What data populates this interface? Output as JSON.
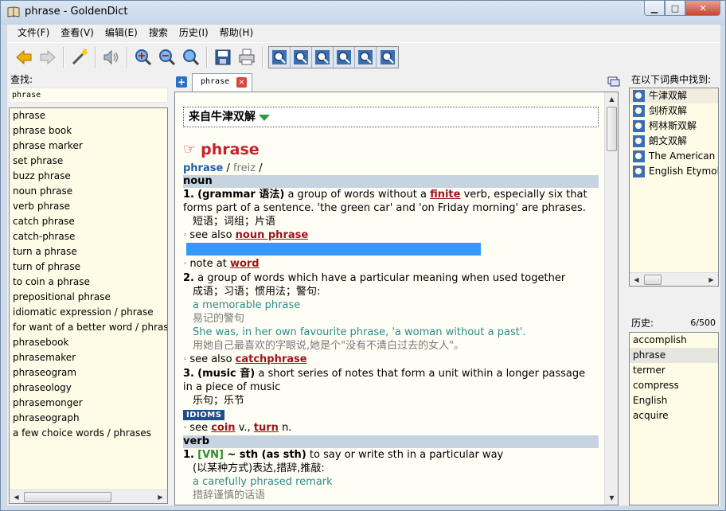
{
  "window": {
    "title": "phrase - GoldenDict"
  },
  "menu": [
    "文件(F)",
    "查看(V)",
    "编辑(E)",
    "搜索",
    "历史(I)",
    "帮助(H)"
  ],
  "toolbar": {
    "buttons": [
      "back-icon",
      "forward-icon",
      "scan-popup-icon",
      "pronounce-icon",
      "zoom-in-icon",
      "zoom-out-icon",
      "zoom-reset-icon",
      "save-icon",
      "print-icon"
    ],
    "dict_buttons": 6
  },
  "left": {
    "label": "查找:",
    "search_value": "phrase",
    "words": [
      "phrase",
      "phrase book",
      "phrase marker",
      "set phrase",
      "buzz phrase",
      "noun phrase",
      "verb phrase",
      "catch phrase",
      "catch-phrase",
      "turn a phrase",
      "turn of phrase",
      "to coin a phrase",
      "prepositional phrase",
      "idiomatic expression / phrase",
      "for want of a better word / phrase",
      "phrasebook",
      "phrasemaker",
      "phraseogram",
      "phraseology",
      "phrasemonger",
      "phraseograph",
      "a few choice words / phrases"
    ]
  },
  "tab": {
    "label": "phrase",
    "close": "×",
    "add": "+"
  },
  "article": {
    "dict_name": "来自牛津双解",
    "headword": "phrase",
    "hand": "☞",
    "pron_word": "phrase",
    "pron_sep": "/",
    "pron_ipa": "freiz",
    "pron_end": "/",
    "pos_noun": "noun",
    "def1_num": "1.",
    "def1_label": "(grammar 语法)",
    "def1_text_a": " a group of words without a ",
    "def1_link": "finite",
    "def1_text_b": " verb, especially six that forms part of a sentence. 'the green car' and 'on Friday morning' are phrases.",
    "def1_cn": "短语；词组；片语",
    "see_also_1_pre": "see also ",
    "see_also_1_link": "noun phrase",
    "note_pre": "note at ",
    "note_link": "word",
    "def2_num": "2.",
    "def2_text": " a group of words which have a particular meaning when used together",
    "def2_cn": "成语；习语；惯用法；警句:",
    "def2_ex1": "a memorable phrase",
    "def2_ex1_cn": "易记的警句",
    "def2_ex2": "She was, in her own favourite phrase, 'a woman without a past'.",
    "def2_ex2_cn": "用她自己最喜欢的字眼说,她是个\"没有不清白过去的女人\"。",
    "see_also_2_pre": "see also ",
    "see_also_2_link": "catchphrase",
    "def3_num": "3.",
    "def3_label": "(music 音)",
    "def3_text": " a short series of notes that form a unit within a longer passage in a piece of music",
    "def3_cn": "乐句；乐节",
    "idioms": "IDIOMS",
    "see_pre": "see ",
    "see_link1": "coin",
    "see_mid": " v., ",
    "see_link2": "turn",
    "see_end": " n.",
    "pos_verb": "verb",
    "v1_num": "1.",
    "v1_code": "[VN]",
    "v1_label": " ~ sth (as sth)",
    "v1_text": " to say or write sth in a particular way",
    "v1_cn": "(以某种方式)表达,措辞,推敲:",
    "v1_ex": "a carefully phrased remark",
    "v1_ex_cn": "措辞谨慎的话语"
  },
  "right": {
    "found_label": "在以下词典中找到:",
    "dictionaries": [
      "牛津双解",
      "剑桥双解",
      "柯林斯双解",
      "朗文双解",
      "The American Heritage",
      "English Etymology"
    ],
    "history_label": "历史:",
    "history_count": "6/500",
    "history": [
      "accomplish",
      "phrase",
      "termer",
      "compress",
      "English",
      "acquire"
    ]
  },
  "colors": {
    "accent": "#c8202b",
    "link": "#a0141e",
    "pos_bar": "#c6d3e0",
    "highlight": "#3399ff",
    "list_bg": "#fefbe6"
  }
}
